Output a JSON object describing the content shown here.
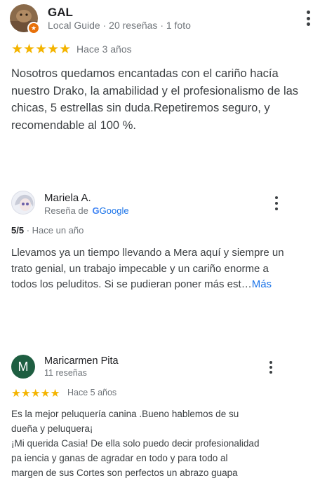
{
  "reviews": [
    {
      "name": "GAL",
      "meta": "Local Guide · 20 reseñas · 1 foto",
      "stars": "★★★★★",
      "time": "Hace 3 años",
      "text": "Nosotros quedamos encantadas con el cariño hacía nuestro Drako, la amabilidad y el profesionalismo de las chicas, 5 estrellas sin duda.Repetiremos seguro, y recomendable al 100 %."
    },
    {
      "name": "Mariela A.",
      "meta_prefix": "Reseña de",
      "google_g": "G",
      "google_word": "Google",
      "score": "5/5",
      "time": "· Hace un año",
      "text": "Llevamos ya un tiempo llevando a Mera aquí y siempre un trato genial, un trabajo impecable y un cariño enorme a todos los peluditos. Si se pudieran poner más est…",
      "more_label": "Más"
    },
    {
      "name": "Maricarmen Pita",
      "avatar_letter": "M",
      "meta": "11 reseñas",
      "stars": "★★★★★",
      "time": "Hace 5 años",
      "text_lines": [
        "Es la mejor peluquería canina .Bueno hablemos de su",
        "dueña y peluquera¡",
        "¡Mi querida Casia! De ella solo puedo decir profesionalidad",
        "pa iencia y ganas de agradar en todo y para todo al",
        "margen de sus Cortes son perfectos un abrazo guapa"
      ]
    }
  ],
  "colors": {
    "star": "#f4b400",
    "link": "#1a73e8",
    "avatar_green": "#1e5e41"
  }
}
